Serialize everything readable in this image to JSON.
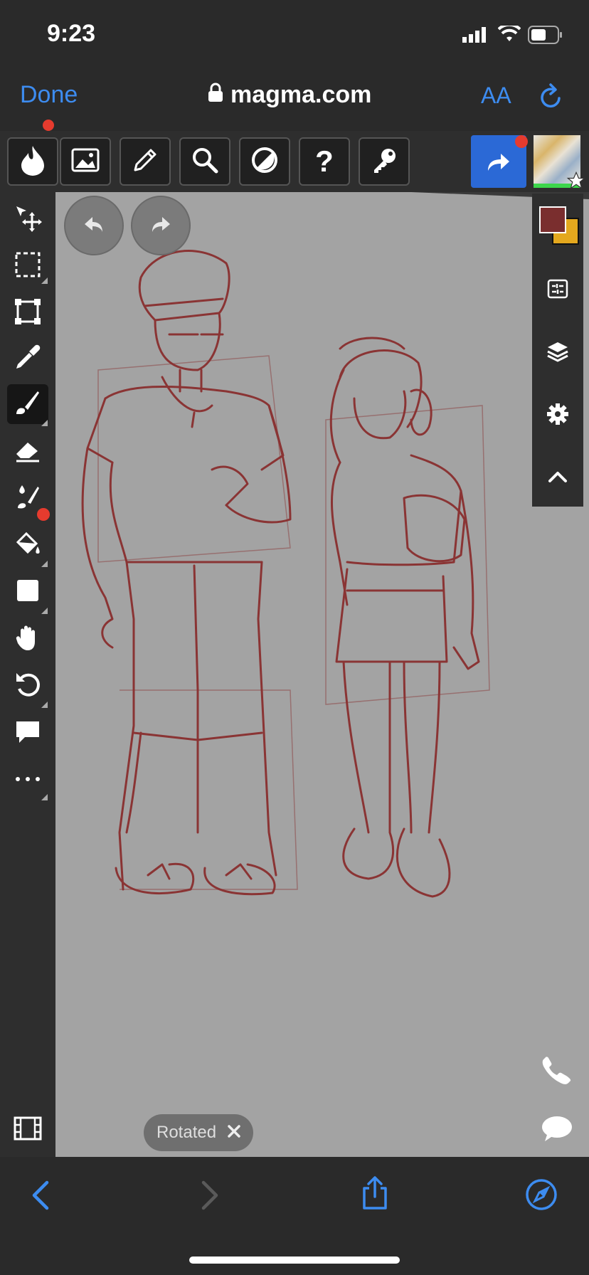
{
  "status_bar": {
    "time": "9:23"
  },
  "browser": {
    "done_label": "Done",
    "url": "magma.com",
    "text_size_label": "AA"
  },
  "toolbar": {
    "tools": [
      "magma-logo-icon",
      "image-icon",
      "pencil-icon",
      "search-icon",
      "contrast-icon",
      "help-icon",
      "key-icon"
    ]
  },
  "left_tools": [
    "move-select-icon",
    "rect-select-icon",
    "transform-icon",
    "eyedropper-icon",
    "brush-icon",
    "eraser-icon",
    "blend-icon",
    "fill-bucket-icon",
    "shape-icon",
    "hand-icon",
    "rotate-icon",
    "comment-icon",
    "more-icon"
  ],
  "canvas": {
    "rotated_label": "Rotated",
    "stroke_color": "#8a3434"
  },
  "colors": {
    "primary": "#7a2e2e",
    "secondary": "#e4a81e",
    "accent": "#3d8cf0"
  }
}
